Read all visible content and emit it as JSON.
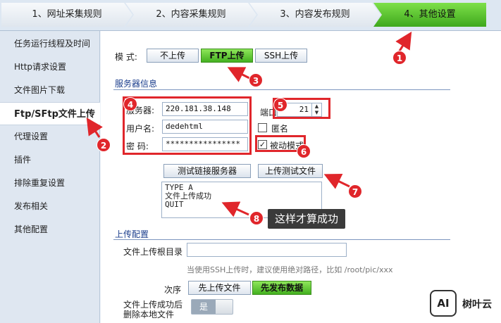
{
  "steps": [
    "1、网址采集规则",
    "2、内容采集规则",
    "3、内容发布规则",
    "4、其他设置"
  ],
  "sidebar": {
    "items": [
      {
        "label": "任务运行线程及时间"
      },
      {
        "label": "Http请求设置"
      },
      {
        "label": "文件图片下载"
      },
      {
        "label": "Ftp/SFtp文件上传",
        "active": true
      },
      {
        "label": "代理设置"
      },
      {
        "label": "插件"
      },
      {
        "label": "排除重复设置"
      },
      {
        "label": "发布相关"
      },
      {
        "label": "其他配置"
      }
    ]
  },
  "mode": {
    "label": "模  式:",
    "options": [
      "不上传",
      "FTP上传",
      "SSH上传"
    ],
    "selected": "FTP上传"
  },
  "server_section": {
    "title": "服务器信息",
    "server_label": "服务器:",
    "server_value": "220.181.38.148",
    "username_label": "用户名:",
    "username_value": "dedehtml",
    "password_label": "密  码:",
    "password_value": "****************",
    "port_label": "端口",
    "port_value": "21",
    "anonymous_label": "匿名",
    "anonymous_checked": false,
    "passive_label": "被动模式",
    "passive_checked": true,
    "test_connect_label": "测试链接服务器",
    "upload_test_label": "上传测试文件",
    "log_text": "TYPE A\n文件上传成功\nQUIT"
  },
  "upload_section": {
    "title": "上传配置",
    "root_label": "文件上传根目录",
    "root_value": "",
    "hint": "当使用SSH上传时，建议使用绝对路径，比如  /root/pic/xxx",
    "order_label": "次序",
    "order_options": [
      "先上传文件",
      "先发布数据"
    ],
    "order_selected": "先发布数据",
    "delete_label_1": "文件上传成功后",
    "delete_label_2": "删除本地文件",
    "delete_toggle": "是"
  },
  "annotations": {
    "badges": [
      "1",
      "2",
      "3",
      "4",
      "5",
      "6",
      "7",
      "8"
    ],
    "callout": "这样才算成功",
    "color": "#e0262b"
  },
  "watermark": {
    "logo": "AI",
    "text": "树叶云"
  }
}
